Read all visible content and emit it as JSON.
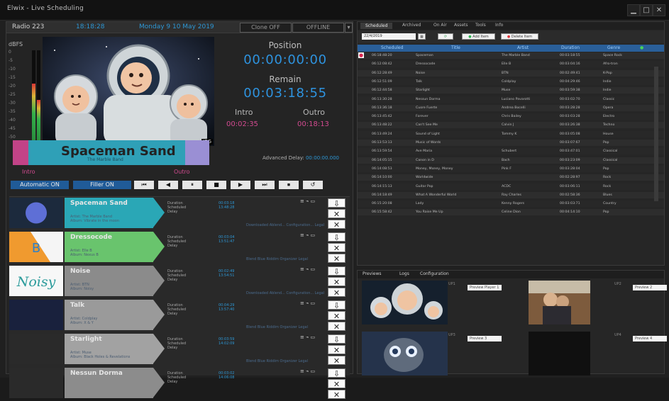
{
  "window": {
    "title": "Elwix - Live Scheduling"
  },
  "left": {
    "station": "Radio 223",
    "clock": "18:18:28",
    "date": "Monday 9 10 May 2019",
    "mode_buttons": [
      "Clone OFF",
      "OFFLINE"
    ],
    "dbfs": "dBFS",
    "meter_levels": [
      0.65,
      0.48
    ],
    "scale": [
      "0",
      "-5",
      "-10",
      "-15",
      "-20",
      "-25",
      "-30",
      "-35",
      "-40",
      "-45",
      "-50"
    ],
    "position_label": "Position",
    "position_value": "00:00:00:00",
    "remain_label": "Remain",
    "remain_value": "00:03:18:55",
    "intro_label": "Intro",
    "outro_label": "Outro",
    "intro_value": "00:02:35",
    "outro_value": "00:18:13",
    "song_title": "Spaceman Sand",
    "song_sub": "The Marble Band",
    "advanced": "Advanced Delay:",
    "advanced_value": "00:00:00.000",
    "intro_marker": "Intro",
    "outro_marker": "Outro",
    "auto_btn": "Automatic ON",
    "filler_btn": "Filler ON",
    "controls": [
      "⏮",
      "◀",
      "⏸",
      "■",
      "▶",
      "⏭",
      "⏹",
      "↺"
    ],
    "playlist": [
      {
        "title": "Spaceman Sand",
        "meta": "Artist: The Marble Band\nAlbum: Vibrate in the moon",
        "link": "Downloaded Ablend... Configuration... Legal",
        "duration": "00:03:18",
        "scheduled": "13:48:28",
        "delay": "",
        "color": "#2aa7b6",
        "thumb_type": "circle"
      },
      {
        "title": "Dressocode",
        "meta": "Artist: Elle B\nAlbum: Nexus B",
        "link": "Blend Blue Riddim Organizer Legal",
        "duration": "00:03:04",
        "scheduled": "13:51:47",
        "delay": "",
        "color": "#69c46d",
        "thumb_type": "stripe"
      },
      {
        "title": "Noise",
        "meta": "Artist: BTN\nAlbum: Noisy",
        "link": "Downloaded Ablend... Configuration... Legal",
        "duration": "00:02:49",
        "scheduled": "13:54:51",
        "delay": "",
        "color": "#8b8b8b",
        "thumb_type": "noisy"
      },
      {
        "title": "Talk",
        "meta": "Artist: Coldplay\nAlbum: X & Y",
        "link": "Blend Blue Riddim Organizer Legal",
        "duration": "00:04:29",
        "scheduled": "13:57:40",
        "delay": "",
        "color": "#9a9a9a",
        "thumb_type": "dark"
      },
      {
        "title": "Starlight",
        "meta": "Artist: Muse\nAlbum: Black Holes & Revelations",
        "link": "Blend Blue Riddim Organizer Legal",
        "duration": "00:03:59",
        "scheduled": "14:02:09",
        "delay": "",
        "color": "#a2a2a2",
        "thumb_type": "plain"
      },
      {
        "title": "Nessun Dorma",
        "meta": "",
        "link": "",
        "duration": "00:03:02",
        "scheduled": "14:06:08",
        "delay": "",
        "color": "#8c8c8c",
        "thumb_type": "plain"
      }
    ],
    "meta_labels": [
      "Duration",
      "Scheduled",
      "Delay"
    ]
  },
  "right": {
    "tabs": [
      "Scheduled",
      "Archived",
      "On Air",
      "Assets",
      "Tools",
      "Info"
    ],
    "date": "22/4/2019",
    "add_item": "Add Item",
    "delete_item": "Delete Item",
    "headers": [
      "Scheduled",
      "Title",
      "Artist",
      "Duration",
      "Genre"
    ],
    "rows": [
      [
        "06:18:48:20",
        "Spaceman",
        "The Marble Band",
        "00:03:18:55",
        "Space Rock"
      ],
      [
        "06:12:08:42",
        "Dressocode",
        "Elle B",
        "00:03:04:16",
        "Afro-tron"
      ],
      [
        "06:12:28:49",
        "Noise",
        "BTN",
        "00:02:49:41",
        "K-Pop"
      ],
      [
        "06:12:51:09",
        "Talk",
        "Coldplay",
        "00:04:29:46",
        "Indie"
      ],
      [
        "06:12:44:58",
        "Starlight",
        "Muse",
        "00:03:59:38",
        "Indie"
      ],
      [
        "06:13:30:28",
        "Nessun Dorma",
        "Luciano Pavarotti",
        "00:03:02:70",
        "Classic"
      ],
      [
        "06:13:36:18",
        "Cuore Fuerte",
        "Andrea Bocelli",
        "00:03:28:28",
        "Opera"
      ],
      [
        "06:13:45:42",
        "Forever",
        "Chris Bailey",
        "00:03:03:28",
        "Electro"
      ],
      [
        "06:13:48:22",
        "Can't See Me",
        "Calvin J",
        "00:03:26:38",
        "Techno"
      ],
      [
        "06:13:49:24",
        "Sound of Light",
        "Tommy K",
        "00:03:05:08",
        "House"
      ],
      [
        "06:13:53:13",
        "Music of Words",
        "",
        "00:03:07:67",
        "Pop"
      ],
      [
        "06:13:59:54",
        "Ave Maria",
        "Schubert",
        "00:03:47:01",
        "Classical"
      ],
      [
        "06:14:05:15",
        "Canon in D",
        "Bach",
        "00:03:23:09",
        "Classical"
      ],
      [
        "06:14:08:53",
        "Money, Money, Money",
        "Pink F",
        "00:03:28:04",
        "Pop"
      ],
      [
        "06:14:10:00",
        "Worldwide",
        "",
        "00:02:28:97",
        "Rock"
      ],
      [
        "06:14:15:13",
        "Guitar Pop",
        "ACDC",
        "00:03:06:11",
        "Rock"
      ],
      [
        "06:14:18:49",
        "What A Wonderful World",
        "Ray Charles",
        "00:02:58:36",
        "Blues"
      ],
      [
        "06:15:20:08",
        "Lady",
        "Kenny Rogers",
        "00:03:03:71",
        "Country"
      ],
      [
        "06:15:58:42",
        "You Raise Me Up",
        "Celine Dion",
        "00:04:14:10",
        "Pop"
      ]
    ],
    "subtabs": [
      "Previews",
      "Logs",
      "Configuration"
    ],
    "preview_labels": [
      "Preview Player 1",
      "Preview 2",
      "Preview 3",
      "Preview 4"
    ],
    "preview_numbers": [
      "UP1",
      "UP2",
      "UP3",
      "UP4"
    ]
  }
}
